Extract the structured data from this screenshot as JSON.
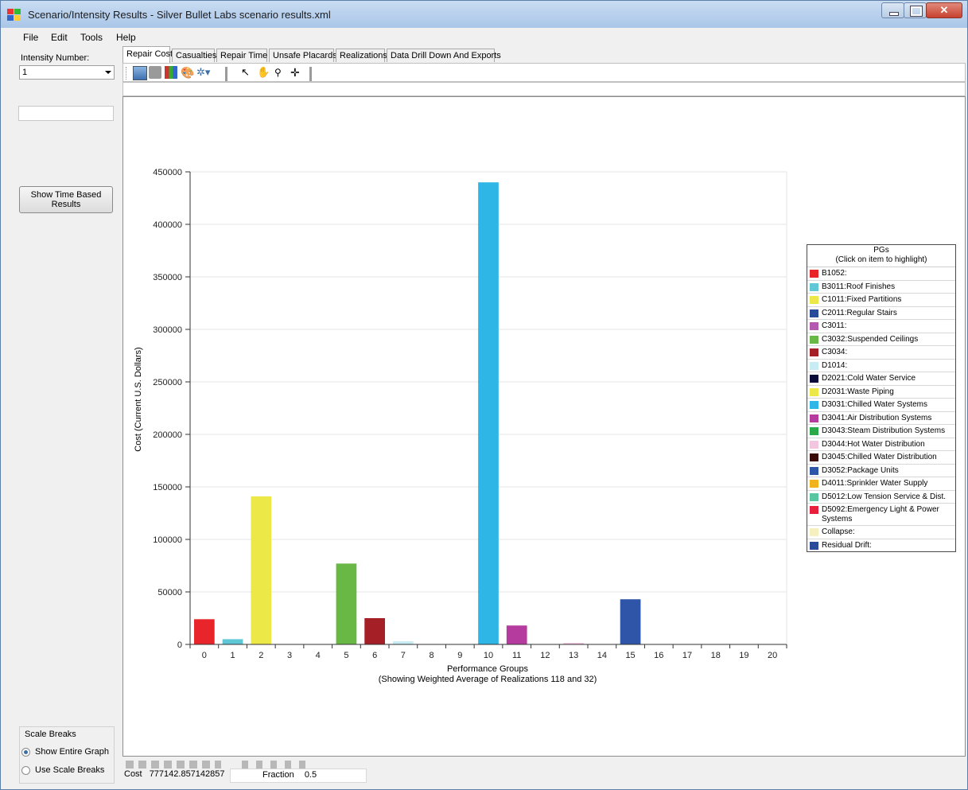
{
  "window": {
    "title": "Scenario/Intensity Results - Silver Bullet Labs scenario results.xml",
    "buttons": {
      "minimize": "minimize-icon",
      "maximize": "maximize-icon",
      "close": "close-icon"
    }
  },
  "menu": [
    "File",
    "Edit",
    "Tools",
    "Help"
  ],
  "left": {
    "intensity_label": "Intensity Number:",
    "intensity_value": "1",
    "time_button": "Show Time Based Results",
    "scale_breaks_label": "Scale Breaks",
    "radio_entire": "Show Entire Graph",
    "radio_breaks": "Use Scale Breaks",
    "selected_radio": "Show Entire Graph"
  },
  "tabs": [
    "Repair Cost",
    "Casualties",
    "Repair Time",
    "Unsafe Placards",
    "Realizations",
    "Data Drill Down And Exports"
  ],
  "active_tab": "Repair Cost",
  "bottom": {
    "cost_label": "Cost",
    "cost_value": "777142.857142857",
    "fraction_label": "Fraction",
    "fraction_value": "0.5"
  },
  "chart_data": {
    "type": "bar",
    "xlabel": "Performance Groups",
    "xsublabel": "(Showing Weighted Average of Realizations 118 and 32)",
    "ylabel": "Cost (Current U.S. Dollars)",
    "ylim": [
      0,
      450000
    ],
    "yticks": [
      0,
      50000,
      100000,
      150000,
      200000,
      250000,
      300000,
      350000,
      400000,
      450000
    ],
    "categories": [
      "0",
      "1",
      "2",
      "3",
      "4",
      "5",
      "6",
      "7",
      "8",
      "9",
      "10",
      "11",
      "12",
      "13",
      "14",
      "15",
      "16",
      "17",
      "18",
      "19",
      "20"
    ],
    "values": [
      24000,
      5000,
      141000,
      0,
      0,
      77000,
      25000,
      3000,
      0,
      0,
      440000,
      18000,
      0,
      1500,
      0,
      43000,
      0,
      0,
      0,
      0,
      0
    ],
    "bar_colors": [
      "#e8252b",
      "#5fc7d6",
      "#ece847",
      "#2c4a9a",
      "#b558b0",
      "#69b845",
      "#a51f27",
      "#c8ecf3",
      "#0a0a3a",
      "#ece847",
      "#2db6e6",
      "#b53c9e",
      "#2aa84a",
      "#f2c6df",
      "#3a0a0a",
      "#2f55a8",
      "#f2b21a",
      "#58c6a0",
      "#e81f3c",
      "#f6efc0",
      "#2c4a9a"
    ],
    "legend": {
      "title": "PGs",
      "subtitle": "(Click on item to  highlight)",
      "placement": "right",
      "items": [
        {
          "label": "B1052:",
          "color": "#e8252b"
        },
        {
          "label": "B3011:Roof Finishes",
          "color": "#5fc7d6"
        },
        {
          "label": "C1011:Fixed Partitions",
          "color": "#ece847"
        },
        {
          "label": "C2011:Regular Stairs",
          "color": "#2c4a9a"
        },
        {
          "label": "C3011:",
          "color": "#b558b0"
        },
        {
          "label": "C3032:Suspended Ceilings",
          "color": "#69b845"
        },
        {
          "label": "C3034:",
          "color": "#a51f27"
        },
        {
          "label": "D1014:",
          "color": "#c8ecf3"
        },
        {
          "label": "D2021:Cold Water Service",
          "color": "#0a0a3a"
        },
        {
          "label": "D2031:Waste Piping",
          "color": "#ece847"
        },
        {
          "label": "D3031:Chilled Water Systems",
          "color": "#2db6e6"
        },
        {
          "label": "D3041:Air Distribution Systems",
          "color": "#b53c9e"
        },
        {
          "label": "D3043:Steam Distribution Systems",
          "color": "#2aa84a"
        },
        {
          "label": "D3044:Hot Water Distribution",
          "color": "#f2c6df"
        },
        {
          "label": "D3045:Chilled Water Distribution",
          "color": "#3a0a0a"
        },
        {
          "label": "D3052:Package Units",
          "color": "#2f55a8"
        },
        {
          "label": "D4011:Sprinkler Water Supply",
          "color": "#f2b21a"
        },
        {
          "label": "D5012:Low Tension Service & Dist.",
          "color": "#58c6a0"
        },
        {
          "label": "D5092:Emergency Light & Power Systems",
          "color": "#e81f3c"
        },
        {
          "label": "Collapse:",
          "color": "#f6efc0"
        },
        {
          "label": "Residual Drift:",
          "color": "#2c4a9a"
        }
      ]
    },
    "grid": true
  }
}
